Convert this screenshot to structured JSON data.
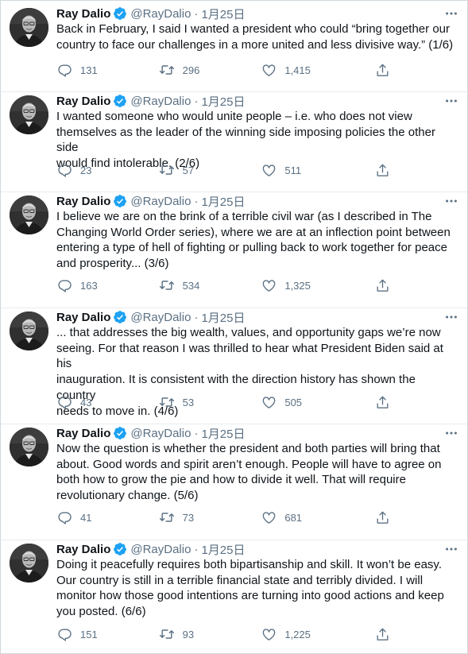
{
  "author": {
    "name": "Ray Dalio",
    "handle": "@RayDalio",
    "date": "1月25日",
    "dot": "·"
  },
  "icons": {
    "reply": "reply-icon",
    "retweet": "retweet-icon",
    "like": "like-icon",
    "share": "share-icon",
    "more": "more-icon",
    "verified": "verified-badge-icon"
  },
  "colors": {
    "verified": "#1da1f2",
    "muted": "#5b7083",
    "text": "#0f1419",
    "divider": "#e6ecf0"
  },
  "tweets": [
    {
      "lines": [
        "Back in February, I said I wanted a president who could “bring together our",
        "country to face our challenges in a more united and less divisive way.” (1/6)"
      ],
      "replies": "131",
      "retweets": "296",
      "likes": "1,415"
    },
    {
      "lines": [
        "I wanted someone who would unite people – i.e. who does not view",
        "themselves as the leader of the winning side imposing policies the other side",
        "would find intolerable. (2/6)"
      ],
      "replies": "23",
      "retweets": "57",
      "likes": "511"
    },
    {
      "lines": [
        "I believe we are on the brink of a terrible civil war (as I described in The",
        "Changing World Order series), where we are at an inflection point between",
        "entering a type of hell of fighting or pulling back to work together for peace",
        "and prosperity... (3/6)"
      ],
      "replies": "163",
      "retweets": "534",
      "likes": "1,325"
    },
    {
      "lines": [
        "... that addresses the big wealth, values, and opportunity gaps we’re now",
        "seeing. For that reason I was thrilled to hear what President Biden said at his",
        "inauguration. It is consistent with the direction history has shown the country",
        "needs to move in. (4/6)"
      ],
      "replies": "43",
      "retweets": "53",
      "likes": "505"
    },
    {
      "lines": [
        "Now the question is whether the president and both parties will bring that",
        "about. Good words and spirit aren’t enough. People will have to agree on",
        "both how to grow the pie and how to divide it well. That will require",
        "revolutionary change. (5/6)"
      ],
      "replies": "41",
      "retweets": "73",
      "likes": "681"
    },
    {
      "lines": [
        "Doing it peacefully requires both bipartisanship and skill. It won’t be easy.",
        "Our country is still in a terrible financial state and terribly divided. I will",
        "monitor how those good intentions are turning into good actions and keep",
        "you posted. (6/6)"
      ],
      "replies": "151",
      "retweets": "93",
      "likes": "1,225"
    }
  ]
}
